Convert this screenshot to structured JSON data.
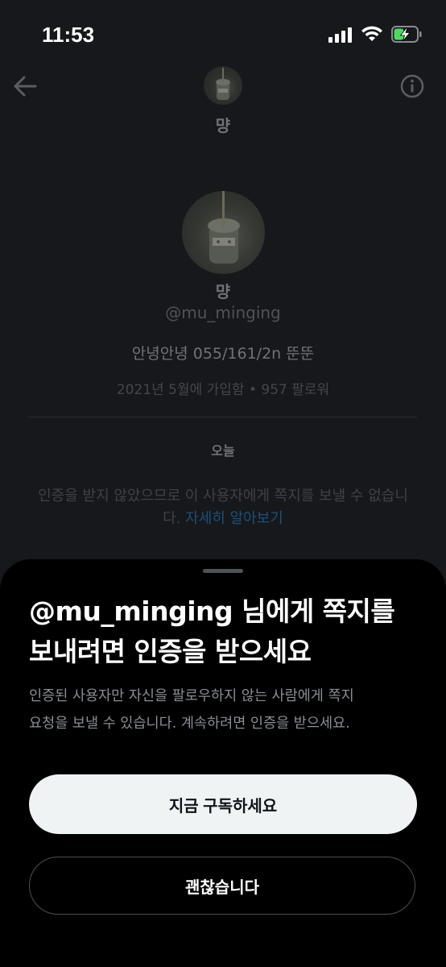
{
  "status_bar": {
    "time": "11:53"
  },
  "header": {
    "name": "먕"
  },
  "profile": {
    "name": "먕",
    "handle": "@mu_minging",
    "bio": "안녕안녕 055/161/2n 뚠뚠",
    "meta": "2021년 5월에 가입함 • 957 팔로워"
  },
  "conversation": {
    "date_label": "오늘",
    "notice_line1": "인증을 받지 않았으므로 이 사용자에게 쪽지를 보낼 수 없습니",
    "notice_line2_prefix": "다. ",
    "notice_link": "자세히 알아보기"
  },
  "sheet": {
    "title_line1": "@mu_minging 님에게 쪽지를",
    "title_line2": "보내려면 인증을 받으세요",
    "body_line1": "인증된 사용자만 자신을 팔로우하지 않는 사람에게 쪽지",
    "body_line2": "요청을 보낼 수 있습니다. 계속하려면 인증을 받으세요.",
    "primary_button": "지금 구독하세요",
    "secondary_button": "괜찮습니다"
  },
  "colors": {
    "background": "#16181b",
    "sheet": "#000000",
    "link": "#1d9bf0",
    "primary_button_bg": "#eff3f4"
  },
  "icons": [
    "back-arrow-icon",
    "info-icon",
    "signal-icon",
    "wifi-icon",
    "battery-charging-icon"
  ]
}
